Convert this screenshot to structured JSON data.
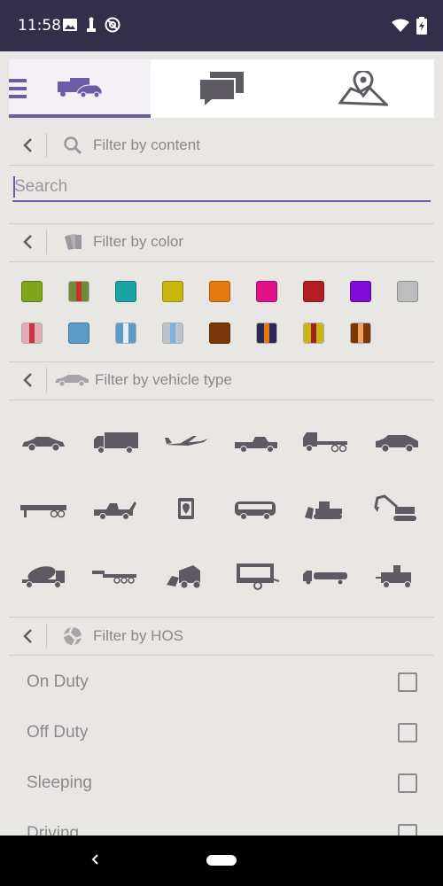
{
  "status": {
    "time": "11:58",
    "colors": {
      "background": "#332f4a"
    },
    "icons": [
      "image-icon",
      "chess-icon",
      "at-sign-icon",
      "wifi-icon",
      "battery-icon"
    ]
  },
  "tabs": [
    {
      "name": "vehicles",
      "icon": "truck-car-icon",
      "active": true
    },
    {
      "name": "messages",
      "icon": "chat-icon",
      "active": false
    },
    {
      "name": "map",
      "icon": "map-pin-icon",
      "active": false
    }
  ],
  "filters": {
    "content": {
      "label": "Filter by content",
      "search_placeholder": "Search",
      "search_value": ""
    },
    "color": {
      "label": "Filter by color"
    },
    "vehicle_type": {
      "label": "Filter by vehicle type"
    },
    "hos": {
      "label": "Filter by HOS"
    }
  },
  "swatches": [
    {
      "c1": "#7fa519",
      "c2": "#7fa519"
    },
    {
      "c1": "#6f8a3a",
      "c2": "#c8342a"
    },
    {
      "c1": "#1aa4a4",
      "c2": "#1aa4a4"
    },
    {
      "c1": "#c9b710",
      "c2": "#c9b710"
    },
    {
      "c1": "#e4790d",
      "c2": "#e4790d"
    },
    {
      "c1": "#e0128a",
      "c2": "#e0128a"
    },
    {
      "c1": "#b21e24",
      "c2": "#b21e24"
    },
    {
      "c1": "#7e0bd6",
      "c2": "#7e0bd6"
    },
    {
      "c1": "#bdbcbe",
      "c2": "#bdbcbe"
    },
    {
      "c1": "#e3a9b4",
      "c2": "#c8343f"
    },
    {
      "c1": "#5b9cc6",
      "c2": "#5b9cc6"
    },
    {
      "c1": "#5b9cc6",
      "c2": "#e2edf6"
    },
    {
      "c1": "#bcc3cc",
      "c2": "#7fb3de"
    },
    {
      "c1": "#7a3508",
      "c2": "#7a3508"
    },
    {
      "c1": "#2a2a5a",
      "c2": "#e4790d"
    },
    {
      "c1": "#c9b710",
      "c2": "#a71d24"
    },
    {
      "c1": "#7a3508",
      "c2": "#f0a15c"
    }
  ],
  "vehicle_types": [
    "sedan-icon",
    "box-truck-icon",
    "airplane-icon",
    "pickup-icon",
    "semi-truck-icon",
    "suv-icon",
    "flatbed-trailer-icon",
    "tow-truck-icon",
    "tracker-device-icon",
    "bus-icon",
    "bulldozer-icon",
    "excavator-icon",
    "mixer-truck-icon",
    "lowboy-trailer-icon",
    "skid-steer-icon",
    "camper-trailer-icon",
    "tanker-truck-icon",
    "generator-icon"
  ],
  "hos": [
    {
      "label": "On Duty",
      "checked": false
    },
    {
      "label": "Off Duty",
      "checked": false
    },
    {
      "label": "Sleeping",
      "checked": false
    },
    {
      "label": "Driving",
      "checked": false
    }
  ],
  "accent": "#6b5ca6"
}
